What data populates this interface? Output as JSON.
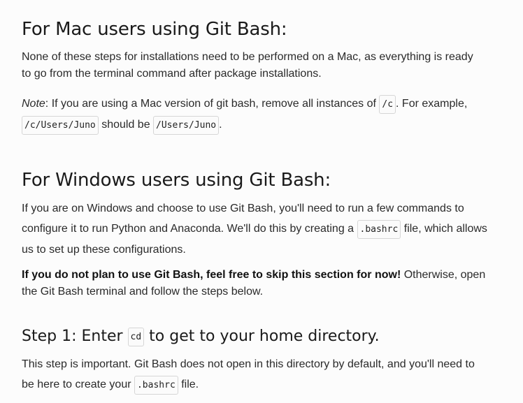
{
  "mac_section": {
    "heading": "For Mac users using Git Bash:",
    "paragraph": "None of these steps for installations need to be performed on a Mac, as everything is ready to go from the terminal command after package installations.",
    "note_label": "Note",
    "note_text_1": ": If you are using a Mac version of git bash, remove all instances of ",
    "note_code_1": "/c",
    "note_text_2": ". For example, ",
    "note_code_2": "/c/Users/Juno",
    "note_text_3": " should be ",
    "note_code_3": "/Users/Juno",
    "note_text_4": "."
  },
  "windows_section": {
    "heading": "For Windows users using Git Bash:",
    "para1_text_1": "If you are on Windows and choose to use Git Bash, you'll need to run a few commands to configure it to run Python and Anaconda. We'll do this by creating a ",
    "para1_code": ".bashrc",
    "para1_text_2": " file, which allows us to set up these configurations.",
    "para2_bold": "If you do not plan to use Git Bash, feel free to skip this section for now!",
    "para2_text": " Otherwise, open the Git Bash terminal and follow the steps below."
  },
  "step1": {
    "heading_text_1": "Step 1: Enter ",
    "heading_code": "cd",
    "heading_text_2": " to get to your home directory.",
    "para_text_1": "This step is important. Git Bash does not open in this directory by default, and you'll need to be here to create your ",
    "para_code": ".bashrc",
    "para_text_2": " file."
  }
}
